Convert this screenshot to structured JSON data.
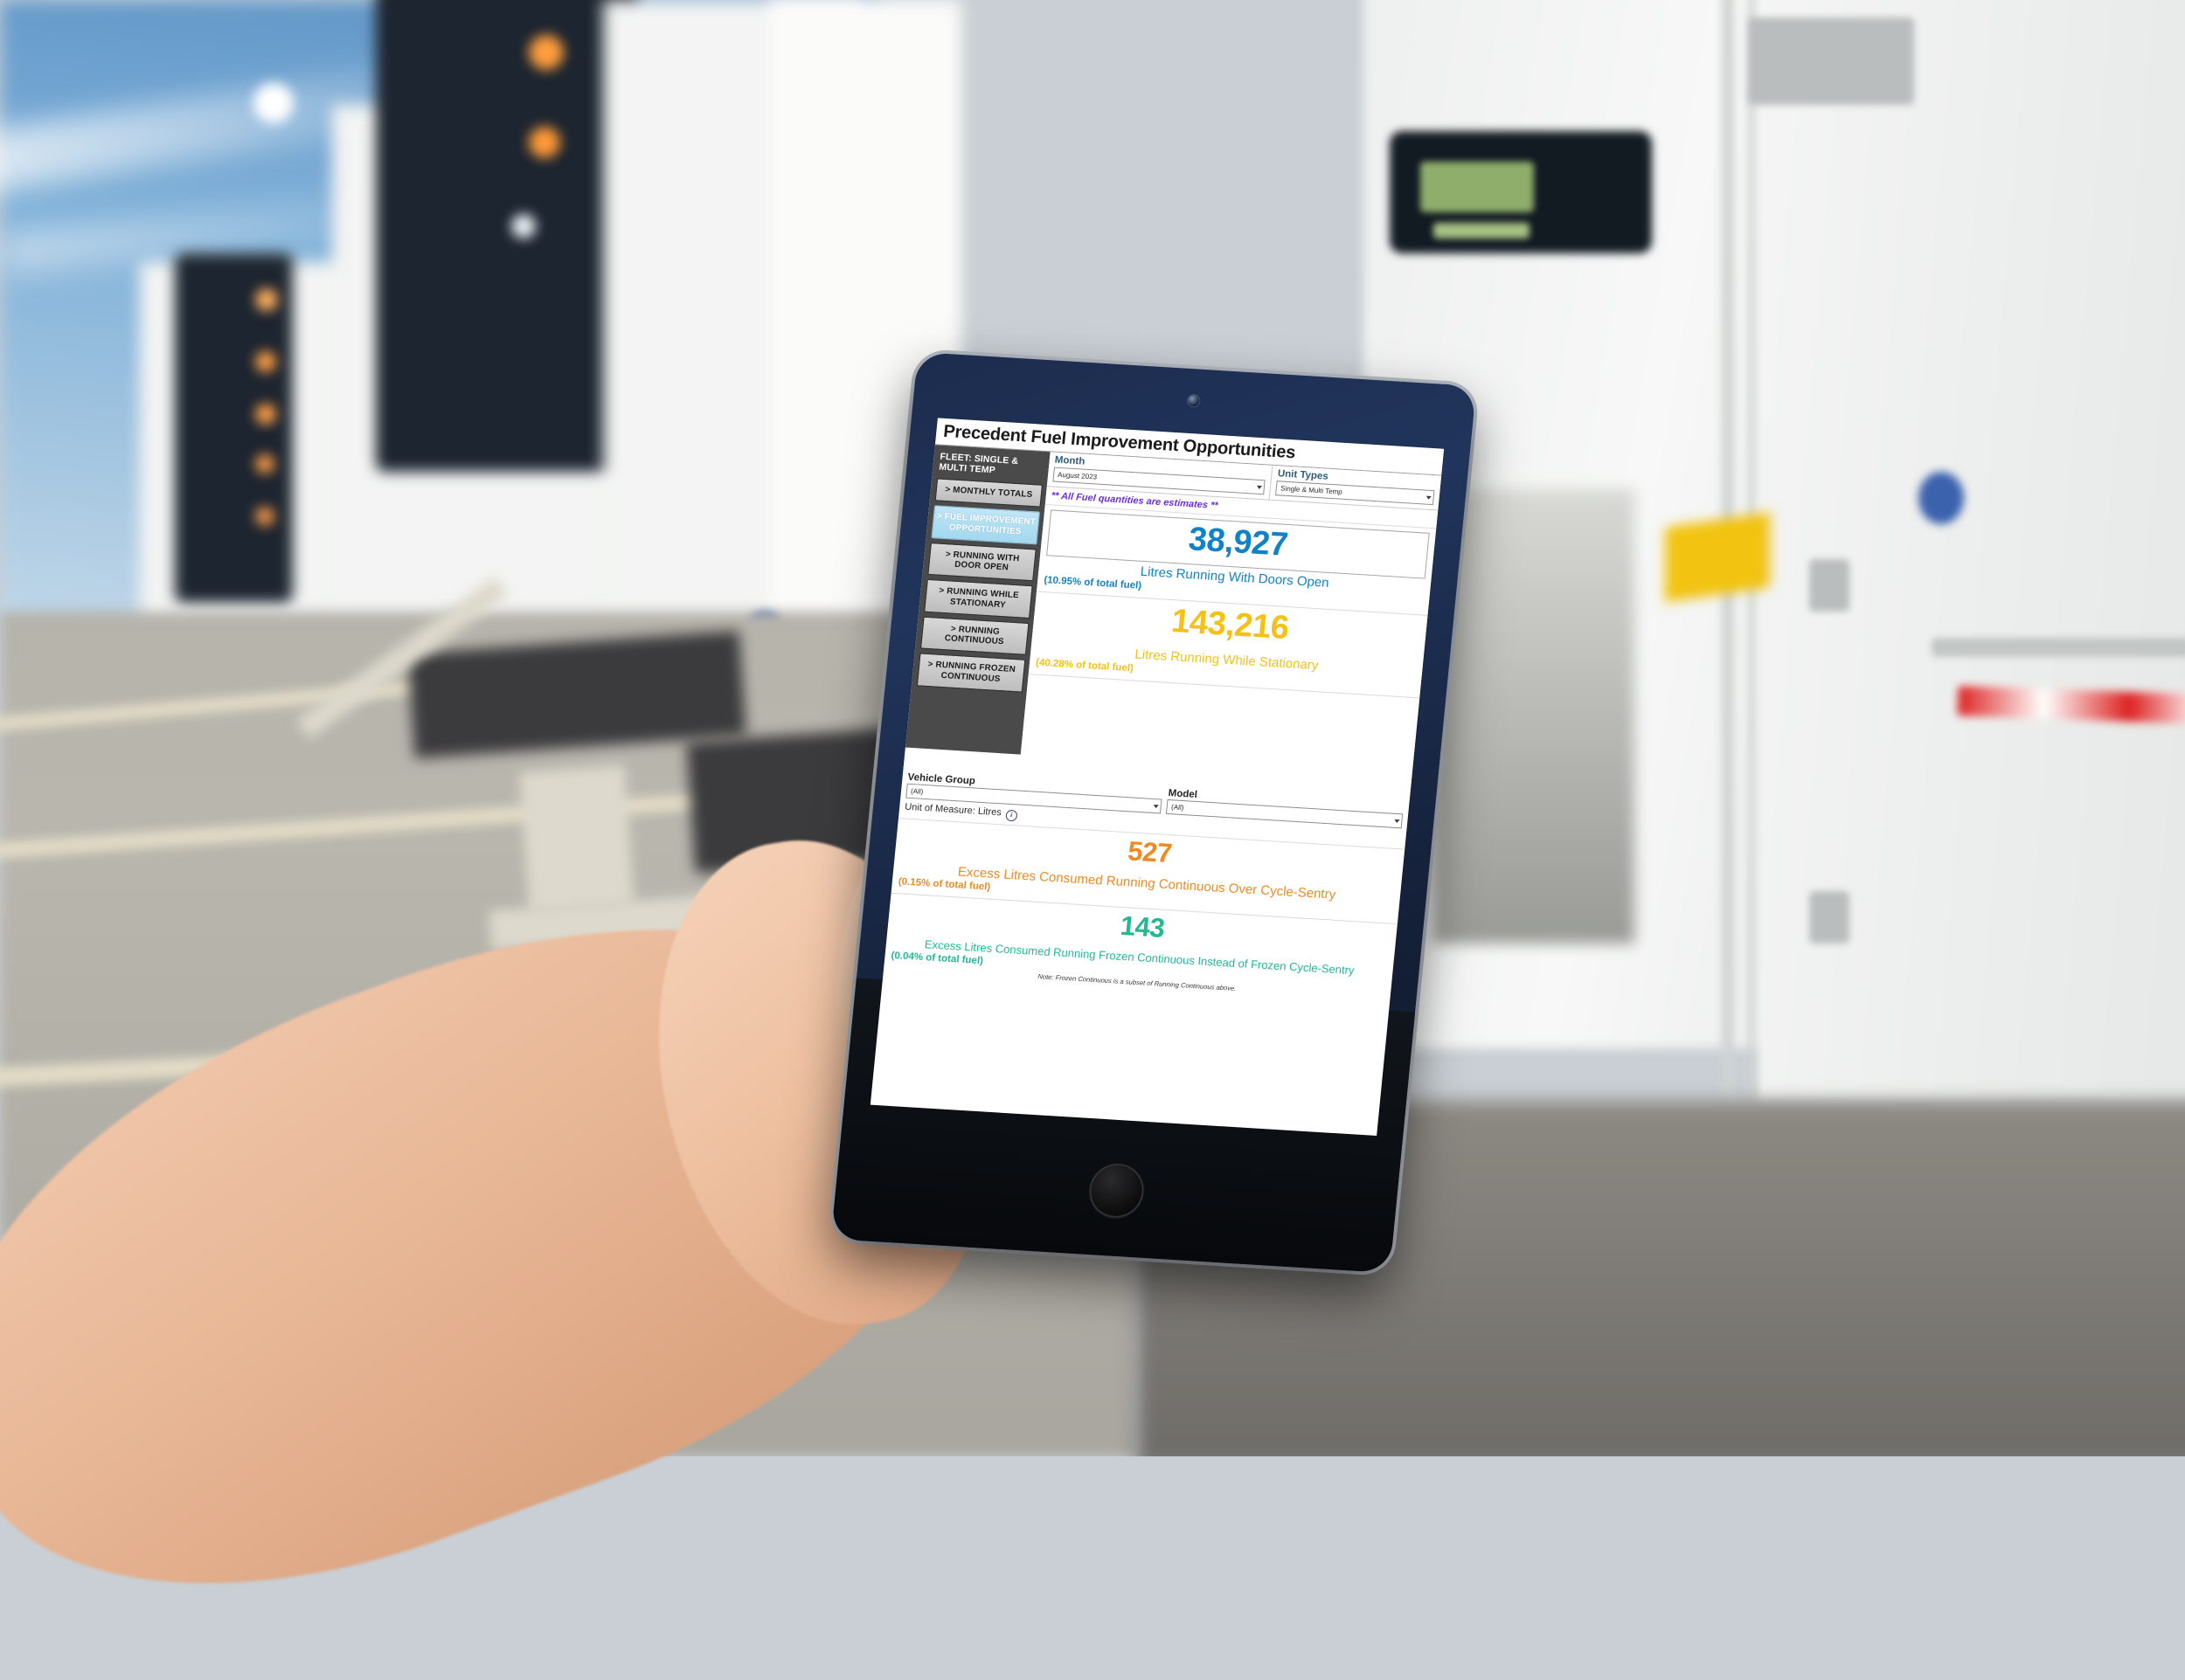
{
  "dashboard": {
    "title": "Precedent Fuel Improvement Opportunities",
    "sidebar": {
      "fleet_header": "FLEET: SINGLE & MULTI TEMP",
      "items": [
        {
          "label": "> MONTHLY TOTALS",
          "active": false
        },
        {
          "label": "> FUEL IMPROVEMENT OPPORTUNITIES",
          "active": true
        },
        {
          "label": "> RUNNING WITH DOOR OPEN",
          "active": false
        },
        {
          "label": "> RUNNING WHILE STATIONARY",
          "active": false
        },
        {
          "label": "> RUNNING CONTINUOUS",
          "active": false
        },
        {
          "label": "> RUNNING FROZEN CONTINUOUS",
          "active": false
        }
      ]
    },
    "filters": {
      "month_label": "Month",
      "month_value": "August 2023",
      "unit_types_label": "Unit Types",
      "unit_types_value": "Single & Multi Temp",
      "vehicle_group_label": "Vehicle Group",
      "vehicle_group_value": "(All)",
      "model_label": "Model",
      "model_value": "(All)",
      "unit_of_measure": "Unit of Measure: Litres"
    },
    "banner": "** All Fuel quantities are estimates **",
    "kpis": [
      {
        "value": "38,927",
        "caption": "Litres Running With Doors Open",
        "percent": "(10.95% of total fuel)",
        "color": "#1282c6"
      },
      {
        "value": "143,216",
        "caption": "Litres Running While Stationary",
        "percent": "(40.28% of total fuel)",
        "color": "#f6c114"
      },
      {
        "value": "527",
        "caption": "Excess Litres Consumed Running Continuous Over Cycle-Sentry",
        "percent": "(0.15% of total fuel)",
        "color": "#ef8a22"
      },
      {
        "value": "143",
        "caption": "Excess Litres Consumed Running Frozen Continuous Instead of Frozen Cycle-Sentry",
        "percent": "(0.04% of total fuel)",
        "color": "#22b896",
        "note": "Note: Frozen Continuous is a subset of Running Continuous above."
      }
    ]
  },
  "colors": {
    "accent_blue": "#1282c6",
    "accent_gold": "#f6c114",
    "accent_orange": "#ef8a22",
    "accent_teal": "#22b896",
    "banner_purple": "#6b2fd6",
    "sidebar_bg": "#4a4a4a",
    "sidebar_active": "#a3d8ef"
  }
}
